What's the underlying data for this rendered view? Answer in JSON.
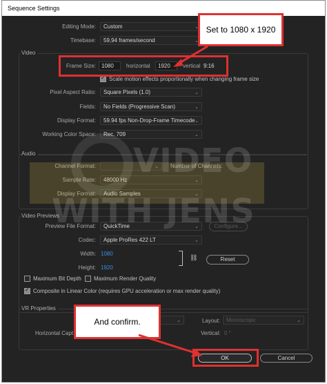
{
  "window": {
    "title": "Sequence Settings"
  },
  "general": {
    "editing_mode_label": "Editing Mode:",
    "editing_mode_value": "Custom",
    "timebase_label": "Timebase:",
    "timebase_value": "59,94  frames/second"
  },
  "video": {
    "section_title": "Video",
    "frame_size_label": "Frame Size:",
    "frame_width": "1080",
    "horizontal_label": "horizontal",
    "frame_height": "1920",
    "vertical_label": "vertical",
    "aspect": "9:16",
    "scale_motion_label": "Scale motion effects proportionally when changing frame size",
    "pixel_aspect_label": "Pixel Aspect Ratio:",
    "pixel_aspect_value": "Square Pixels (1.0)",
    "fields_label": "Fields:",
    "fields_value": "No Fields (Progressive Scan)",
    "display_format_label": "Display Format:",
    "display_format_value": "59.94 fps Non-Drop-Frame Timecode",
    "color_space_label": "Working Color Space:",
    "color_space_value": "Rec. 709"
  },
  "audio": {
    "section_title": "Audio",
    "channel_format_label": "Channel Format:",
    "number_channels_label": "Number of Channels:",
    "sample_rate_label": "Sample Rate:",
    "sample_rate_value": "48000 Hz",
    "display_format_label": "Display Format:",
    "display_format_value": "Audio Samples"
  },
  "previews": {
    "section_title": "Video Previews",
    "file_format_label": "Preview File Format:",
    "file_format_value": "QuickTime",
    "configure_label": "Configure...",
    "codec_label": "Codec:",
    "codec_value": "Apple ProRes 422 LT",
    "width_label": "Width:",
    "width_value": "1080",
    "height_label": "Height:",
    "height_value": "1920",
    "reset_label": "Reset",
    "max_bit_depth_label": "Maximum Bit Depth",
    "max_render_label": "Maximum Render Quality",
    "composite_label": "Composite in Linear Color (requires GPU acceleration or max render quality)"
  },
  "vr": {
    "section_title": "VR Properties",
    "horizontal_label": "Horizontal Capt",
    "layout_label": "Layout:",
    "layout_value": "Monoscopic",
    "vertical_label": "Vertical:",
    "vertical_value": "0 °"
  },
  "buttons": {
    "ok_label": "OK",
    "cancel_label": "Cancel"
  },
  "annotations": {
    "callout_top": "Set to 1080 x 1920",
    "callout_bottom": "And confirm.",
    "accent_color": "#e03030"
  },
  "watermark": {
    "line1": "VIDEO",
    "line2": "WITH JENS"
  }
}
